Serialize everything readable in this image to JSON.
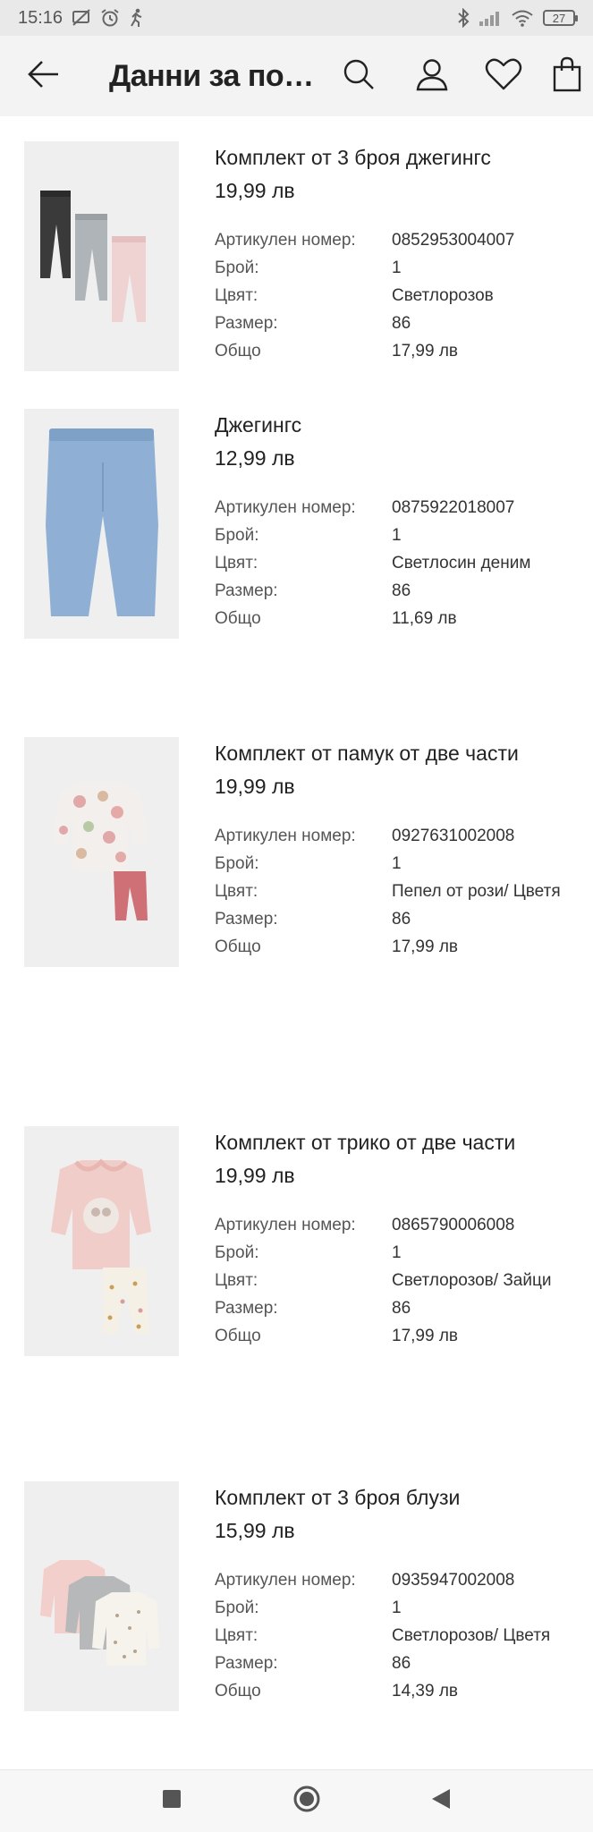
{
  "status_bar": {
    "time": "15:16",
    "battery": "27",
    "left_icons": [
      "cast-off-icon",
      "alarm-icon",
      "walking-icon"
    ],
    "right_icons": [
      "bluetooth-icon",
      "signal-icon",
      "wifi-icon",
      "battery-icon"
    ]
  },
  "header": {
    "title": "Данни за по…",
    "icons": [
      "back-arrow-icon",
      "search-icon",
      "account-icon",
      "heart-icon",
      "bag-icon"
    ]
  },
  "labels": {
    "article": "Артикулен номер:",
    "qty": "Брой:",
    "color": "Цвят:",
    "size": "Размер:",
    "total": "Общо"
  },
  "items": [
    {
      "name": "Комплект от 3 броя джегингс",
      "price": "19,99 лв",
      "article": "0852953004007",
      "qty": "1",
      "color": "Светлорозов",
      "size": "86",
      "total": "17,99 лв"
    },
    {
      "name": "Джегингс",
      "price": "12,99 лв",
      "article": "0875922018007",
      "qty": "1",
      "color": "Светлосин деним",
      "size": "86",
      "total": "11,69 лв"
    },
    {
      "name": "Комплект от памук от две части",
      "price": "19,99 лв",
      "article": "0927631002008",
      "qty": "1",
      "color": "Пепел от рози/ Цветя",
      "size": "86",
      "total": "17,99 лв"
    },
    {
      "name": "Комплект от трико от две части",
      "price": "19,99 лв",
      "article": "0865790006008",
      "qty": "1",
      "color": "Светлорозов/ Зайци",
      "size": "86",
      "total": "17,99 лв"
    },
    {
      "name": "Комплект от 3 броя блузи",
      "price": "15,99 лв",
      "article": "0935947002008",
      "qty": "1",
      "color": "Светлорозов/ Цветя",
      "size": "86",
      "total": "14,39 лв"
    }
  ],
  "nav_bar": {
    "icons": [
      "recents-square-icon",
      "home-circle-icon",
      "back-triangle-icon"
    ]
  }
}
